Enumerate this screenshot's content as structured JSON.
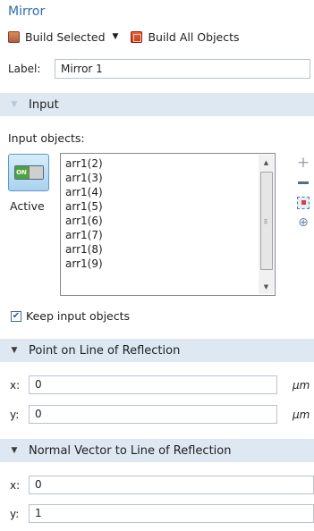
{
  "panel": {
    "title": "Mirror",
    "build_selected": "Build Selected",
    "build_all": "Build All Objects"
  },
  "label_field": {
    "label": "Label:",
    "value": "Mirror 1"
  },
  "input_section": {
    "title": "Input",
    "input_objects_label": "Input objects:",
    "active_toggle_text": "ON",
    "active_label": "Active",
    "objects": [
      "arr1(2)",
      "arr1(3)",
      "arr1(4)",
      "arr1(5)",
      "arr1(6)",
      "arr1(7)",
      "arr1(8)",
      "arr1(9)"
    ],
    "keep_input_label": "Keep input objects",
    "keep_input_checked": true,
    "side_buttons": [
      "add-icon",
      "remove-icon",
      "select-icon",
      "zoom-selection-icon"
    ]
  },
  "point_section": {
    "title": "Point on Line of Reflection",
    "x_label": "x:",
    "x_value": "0",
    "x_unit": "µm",
    "y_label": "y:",
    "y_value": "0",
    "y_unit": "µm"
  },
  "normal_section": {
    "title": "Normal Vector to Line of Reflection",
    "x_label": "x:",
    "x_value": "0",
    "y_label": "y:",
    "y_value": "1"
  },
  "colors": {
    "title": "#2a6db2",
    "section_bg": "#dde8f3",
    "toggle_on": "#4da43e"
  }
}
